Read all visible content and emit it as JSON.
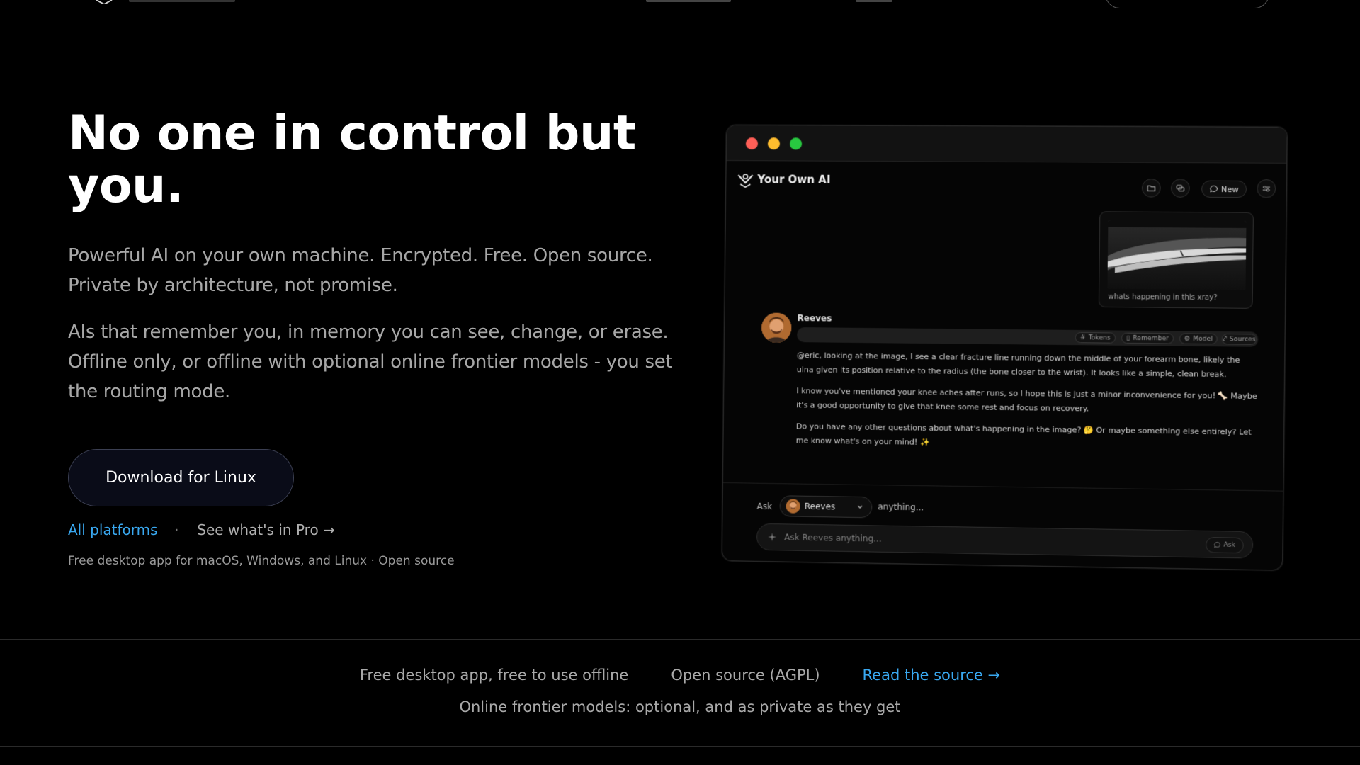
{
  "hero": {
    "title": "No one in control but you.",
    "paragraph_1": "Powerful AI on your own machine. Encrypted. Free. Open source. Private by architecture, not promise.",
    "paragraph_2": "AIs that remember you, in memory you can see, change, or erase. Offline only, or offline with optional online frontier models - you set the routing mode.",
    "download_label": "Download for Linux",
    "all_platforms_label": "All platforms",
    "separator": "·",
    "pro_label": "See what's in Pro →",
    "note": "Free desktop app for macOS, Windows, and Linux · Open source"
  },
  "mock": {
    "app_title": "Your Own AI",
    "new_label": "New",
    "xray_caption": "whats happening in this xray?",
    "agent_name": "Reeves",
    "toolbar": {
      "tokens": "Tokens",
      "remember": "Remember",
      "model": "Model",
      "sources": "Sources"
    },
    "message": {
      "para_1": "@eric, looking at the image, I see a clear fracture line running down the middle of your forearm bone, likely the ulna given its position relative to the radius (the bone closer to the wrist). It looks like a simple, clean break.",
      "para_2": "I know you've mentioned your knee aches after runs, so I hope this is just a minor inconvenience for you! 🦴 Maybe it's a good opportunity to give that knee some rest and focus on recovery.",
      "para_3": "Do you have any other questions about what's happening in the image? 🤔 Or maybe something else entirely? Let me know what's on your mind! ✨"
    },
    "ask_label": "Ask",
    "ask_suffix": "anything...",
    "input_placeholder": "Ask Reeves anything...",
    "ask_button": "Ask"
  },
  "band": {
    "item_1": "Free desktop app, free to use offline",
    "item_2": "Open source (AGPL)",
    "item_3": "Read the source →",
    "line_2": "Online frontier models: optional, and as private as they get"
  },
  "colors": {
    "background": "#000000",
    "accent_link": "#39a8f0",
    "muted_text": "#a7a7a7",
    "traffic_red": "#ff5f57",
    "traffic_yellow": "#febc2e",
    "traffic_green": "#28c840"
  },
  "icons": {
    "logo": "brand-logo-icon",
    "folder": "folder-icon",
    "chats": "chats-icon",
    "new_chat": "chat-bubble-icon",
    "settings": "sliders-icon",
    "chevron": "chevron-down-icon"
  }
}
